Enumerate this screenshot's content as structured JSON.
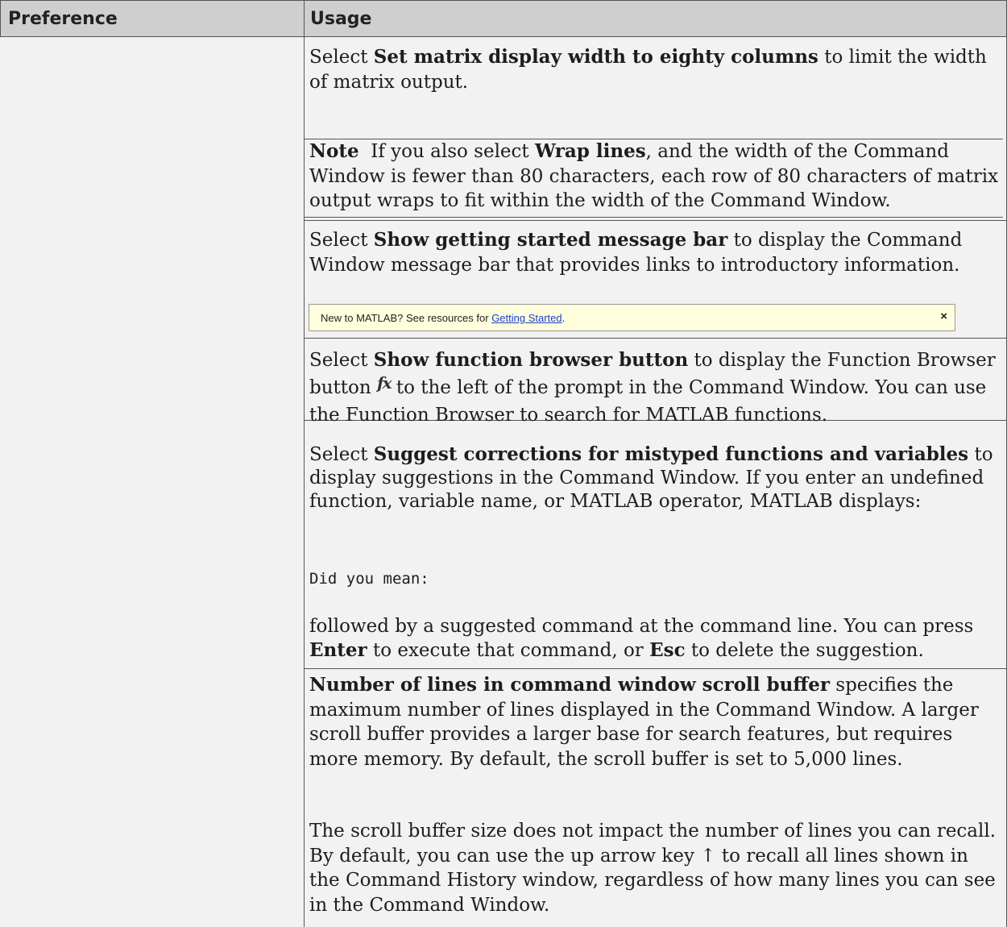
{
  "header": {
    "col1": "Preference",
    "col2": "Usage"
  },
  "rows": {
    "matrix": {
      "pre": "Select ",
      "bold": "Set matrix display width to eighty columns",
      "post": " to limit the width of matrix output."
    },
    "note": {
      "label": "Note",
      "pre": "  If you also select ",
      "bold": "Wrap lines",
      "post": ", and the width of the Command Window is fewer than 80 characters, each row of 80 characters of matrix output wraps to fit within the width of the Command Window."
    },
    "msgbar": {
      "pre": "Select ",
      "bold": "Show getting started message bar",
      "post": " to display the Command Window message bar that provides links to introductory information."
    },
    "banner": {
      "text": "New to MATLAB? See resources for ",
      "link": "Getting Started",
      "end": ".",
      "close": "×"
    },
    "funcbrowser": {
      "pre": "Select ",
      "bold": "Show function browser button",
      "mid": " to display the Function Browser button ",
      "icon": "function-browser-icon",
      "post": " to the left of the prompt in the Command Window. You can use the Function Browser to search for MATLAB functions."
    },
    "suggest": {
      "pre": "Select ",
      "bold": "Suggest corrections for mistyped functions and variables",
      "post": " to display suggestions in the Command Window. If you enter an undefined function, variable name, or MATLAB operator, MATLAB displays:",
      "code": "Did you mean:",
      "follow_pre": "followed by a suggested command at the command line. You can press ",
      "key1": "Enter",
      "follow_mid": " to execute that command, or ",
      "key2": "Esc",
      "follow_post": " to delete the suggestion."
    },
    "scroll": {
      "bold": "Number of lines in command window scroll buffer",
      "post": " specifies the maximum number of lines displayed in the Command Window. A larger scroll buffer provides a larger base for search features, but requires more memory. By default, the scroll buffer is set to 5,000 lines.",
      "para2": "The scroll buffer size does not impact the number of lines you can recall. By default, you can use the up arrow key ↑ to recall all lines shown in the Command History window, regardless of how many lines you can see in the Command Window."
    }
  }
}
